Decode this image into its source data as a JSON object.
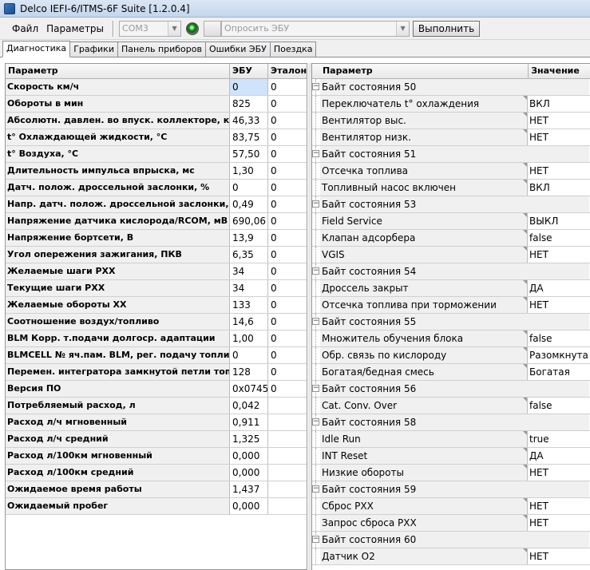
{
  "window": {
    "title": "Delco IEFI-6/ITMS-6F Suite [1.2.0.4]"
  },
  "menu": {
    "file": "Файл",
    "params": "Параметры"
  },
  "toolbar": {
    "port": "COM3",
    "query_placeholder": "Опросить ЭБУ",
    "execute": "Выполнить"
  },
  "tabs": [
    "Диагностика",
    "Графики",
    "Панель приборов",
    "Ошибки ЭБУ",
    "Поездка"
  ],
  "left_table": {
    "headers": [
      "Параметр",
      "ЭБУ",
      "Эталон"
    ],
    "rows": [
      {
        "name": "Скорость км/ч",
        "ecu": "0",
        "ref": "0"
      },
      {
        "name": "Обороты в мин",
        "ecu": "825",
        "ref": "0"
      },
      {
        "name": "Абсолютн. давлен. во впуск. коллекторе, кПа",
        "ecu": "46,33",
        "ref": "0"
      },
      {
        "name": "t° Охлаждающей жидкости, °C",
        "ecu": "83,75",
        "ref": "0"
      },
      {
        "name": "t° Воздуха, °C",
        "ecu": "57,50",
        "ref": "0"
      },
      {
        "name": "Длительность импульса впрыска, мс",
        "ecu": "1,30",
        "ref": "0"
      },
      {
        "name": "Датч. полож. дроссельной заслонки, %",
        "ecu": "0",
        "ref": "0"
      },
      {
        "name": "Напр. датч. полож. дроссельной заслонки, В",
        "ecu": "0,49",
        "ref": "0"
      },
      {
        "name": "Напряжение датчика кислорода/RCOM, мВ",
        "ecu": "690,06",
        "ref": "0"
      },
      {
        "name": "Напряжение бортсети, В",
        "ecu": "13,9",
        "ref": "0"
      },
      {
        "name": "Угол опережения зажигания, ПКВ",
        "ecu": "6,35",
        "ref": "0"
      },
      {
        "name": "Желаемые шаги РХХ",
        "ecu": "34",
        "ref": "0"
      },
      {
        "name": "Текущие шаги РХХ",
        "ecu": "34",
        "ref": "0"
      },
      {
        "name": "Желаемые обороты ХХ",
        "ecu": "133",
        "ref": "0"
      },
      {
        "name": "Соотношение воздух/топливо",
        "ecu": "14,6",
        "ref": "0"
      },
      {
        "name": "BLM Корр. т.подачи долгоср. адаптации",
        "ecu": "1,00",
        "ref": "0"
      },
      {
        "name": "BLMCELL № яч.пам. BLM, рег. подачу топлива",
        "ecu": "0",
        "ref": "0"
      },
      {
        "name": "Перемен. интегратора замкнутой петли топл.",
        "ecu": "128",
        "ref": "0"
      },
      {
        "name": "Версия ПО",
        "ecu": "0x0745",
        "ref": "0"
      },
      {
        "name": "Потребляемый расход, л",
        "ecu": "0,042",
        "ref": ""
      },
      {
        "name": "Расход л/ч мгновенный",
        "ecu": "0,911",
        "ref": ""
      },
      {
        "name": "Расход л/ч средний",
        "ecu": "1,325",
        "ref": ""
      },
      {
        "name": "Расход л/100км мгновенный",
        "ecu": "0,000",
        "ref": ""
      },
      {
        "name": "Расход л/100км средний",
        "ecu": "0,000",
        "ref": ""
      },
      {
        "name": "Ожидаемое время работы",
        "ecu": "1,437",
        "ref": ""
      },
      {
        "name": "Ожидаемый пробег",
        "ecu": "0,000",
        "ref": ""
      }
    ]
  },
  "right_table": {
    "headers": [
      "Параметр",
      "Значение"
    ],
    "rows": [
      {
        "type": "group",
        "name": "Байт состояния 50"
      },
      {
        "type": "item",
        "name": "Переключатель t° охлаждения",
        "value": "ВКЛ"
      },
      {
        "type": "item",
        "name": "Вентилятор выс.",
        "value": "НЕТ"
      },
      {
        "type": "item",
        "name": "Вентилятор низк.",
        "value": "НЕТ"
      },
      {
        "type": "group",
        "name": "Байт состояния 51"
      },
      {
        "type": "item",
        "name": "Отсечка топлива",
        "value": "НЕТ"
      },
      {
        "type": "item",
        "name": "Топливный насос включен",
        "value": "ВКЛ"
      },
      {
        "type": "group",
        "name": "Байт состояния 53"
      },
      {
        "type": "item",
        "name": "Field Service",
        "value": "ВЫКЛ"
      },
      {
        "type": "item",
        "name": "Клапан адсорбера",
        "value": "false"
      },
      {
        "type": "item",
        "name": "VGIS",
        "value": "НЕТ"
      },
      {
        "type": "group",
        "name": "Байт состояния 54"
      },
      {
        "type": "item",
        "name": "Дроссель закрыт",
        "value": "ДА"
      },
      {
        "type": "item",
        "name": "Отсечка топлива при торможении",
        "value": "НЕТ"
      },
      {
        "type": "group",
        "name": "Байт состояния 55"
      },
      {
        "type": "item",
        "name": "Множитель обучения блока",
        "value": "false"
      },
      {
        "type": "item",
        "name": "Обр. связь по кислороду",
        "value": "Разомкнута"
      },
      {
        "type": "item",
        "name": "Богатая/бедная смесь",
        "value": "Богатая"
      },
      {
        "type": "group",
        "name": "Байт состояния 56"
      },
      {
        "type": "item",
        "name": "Cat. Conv. Over",
        "value": "false"
      },
      {
        "type": "group",
        "name": "Байт состояния 58"
      },
      {
        "type": "item",
        "name": "Idle Run",
        "value": "true"
      },
      {
        "type": "item",
        "name": "INT Reset",
        "value": "ДА"
      },
      {
        "type": "item",
        "name": "Низкие обороты",
        "value": "НЕТ"
      },
      {
        "type": "group",
        "name": "Байт состояния 59"
      },
      {
        "type": "item",
        "name": "Сброс РХХ",
        "value": "НЕТ"
      },
      {
        "type": "item",
        "name": "Запрос сброса РХХ",
        "value": "НЕТ"
      },
      {
        "type": "group",
        "name": "Байт состояния 60"
      },
      {
        "type": "item",
        "name": "Датчик О2",
        "value": "НЕТ"
      }
    ]
  }
}
